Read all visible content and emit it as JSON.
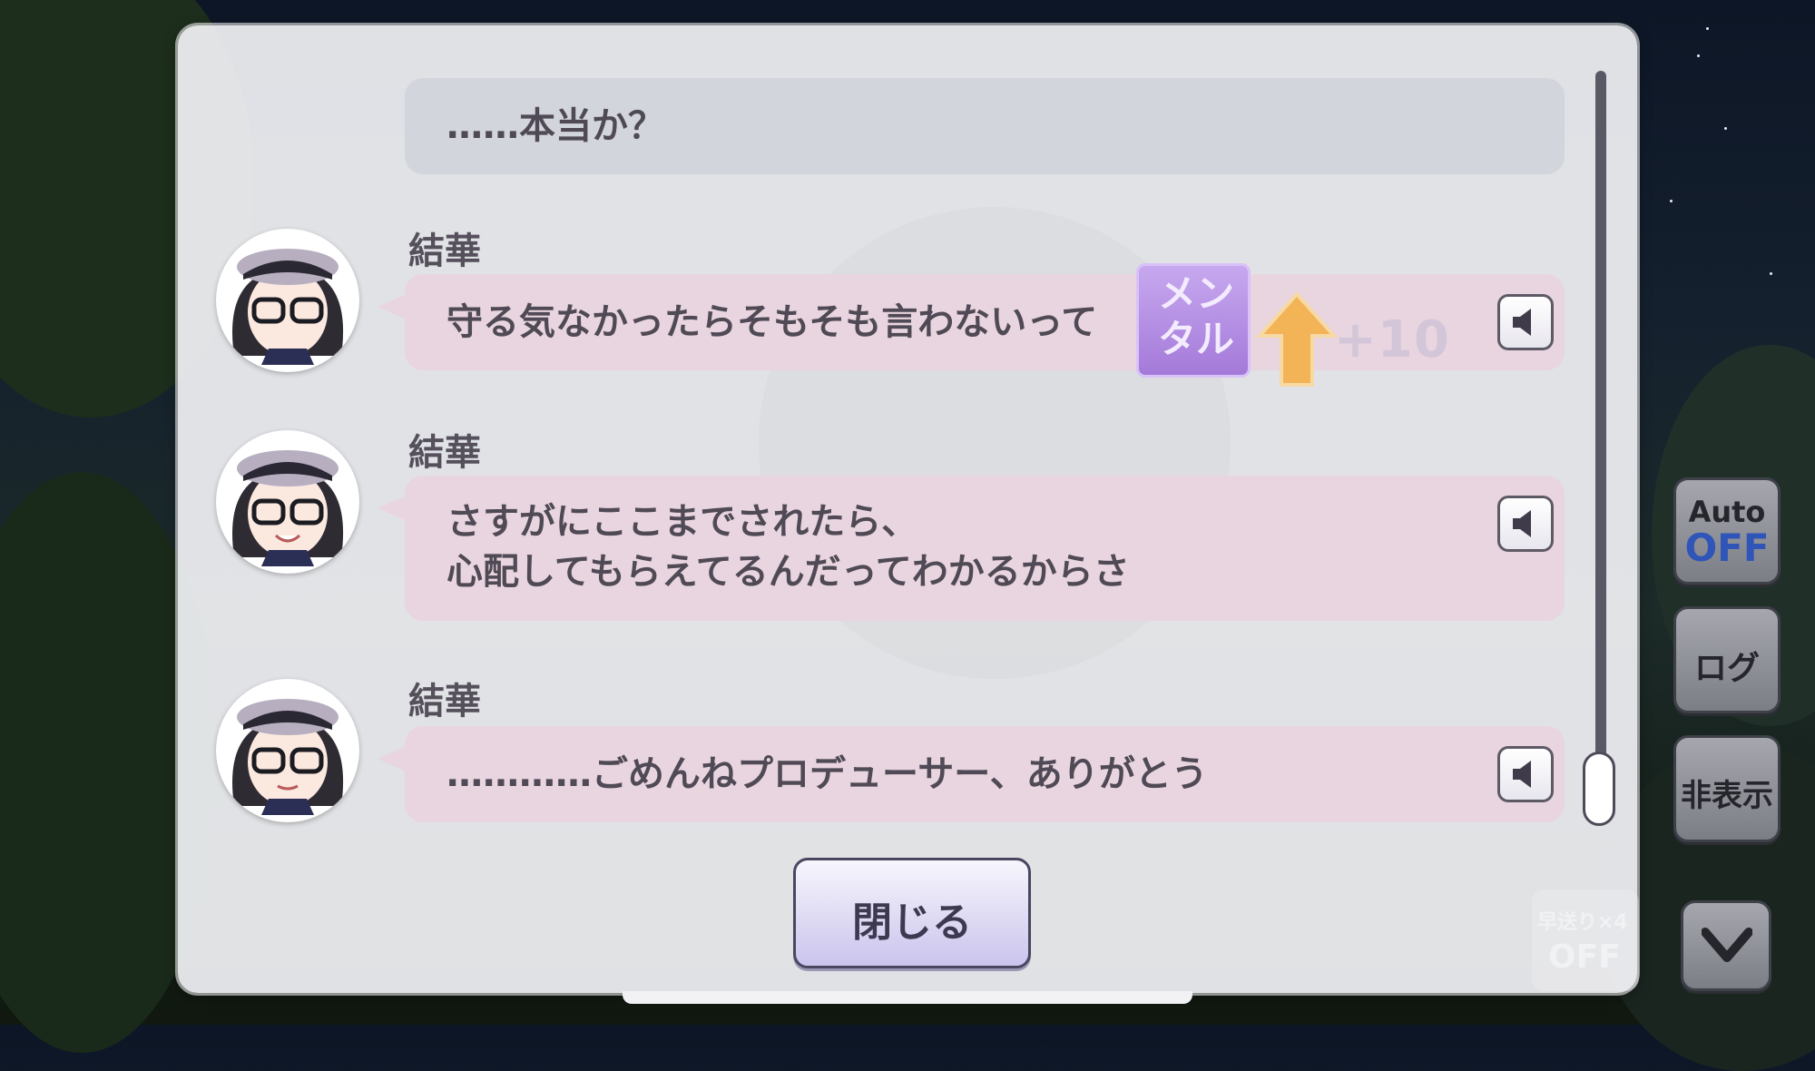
{
  "log": {
    "entries": [
      {
        "speaker": "",
        "text": "……本当か？"
      },
      {
        "speaker": "結華",
        "text": "守る気なかったらそもそも言わないって"
      },
      {
        "speaker": "結華",
        "text": "さすがにここまでされたら、\n心配してもらえてるんだってわかるからさ"
      },
      {
        "speaker": "結華",
        "text": "…………ごめんねプロデューサー、ありがとう"
      }
    ],
    "close_label": "閉じる"
  },
  "stat_popup": {
    "badge_text": "メン\nタル",
    "amount": "+10"
  },
  "side_controls": {
    "auto_label": "Auto",
    "auto_state": "OFF",
    "log_label": "ログ",
    "hide_label": "非表示",
    "fast_forward_label": "早送り×4",
    "fast_forward_state": "OFF"
  },
  "colors": {
    "speech_bubble": "#e9d5df",
    "narration_bubble": "#d3d5dc",
    "auto_off": "#2f55b8",
    "stat_badge": "#b48ee3",
    "arrow": "#f3b458"
  },
  "icons": [
    "speaker-icon",
    "arrow-up-icon",
    "chevron-down-icon"
  ]
}
